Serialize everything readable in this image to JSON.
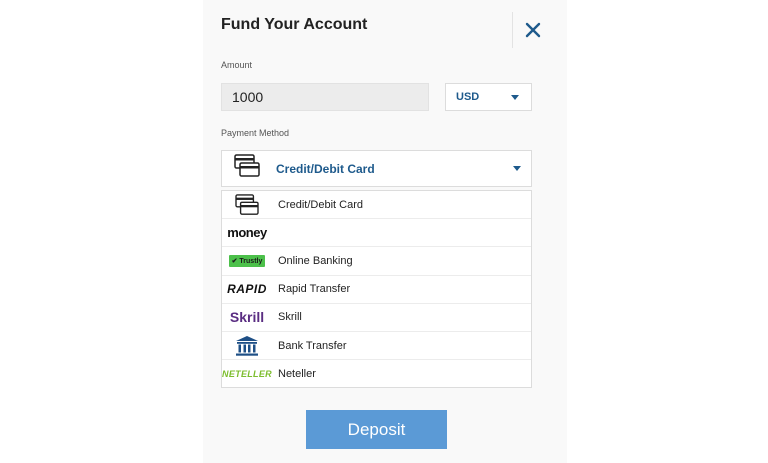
{
  "dialog": {
    "title": "Fund Your Account",
    "close_icon": "close-icon"
  },
  "amount": {
    "label": "Amount",
    "value": "1000",
    "currency": "USD"
  },
  "payment": {
    "label": "Payment Method",
    "selected": "Credit/Debit Card",
    "selected_icon": "credit-card-icon",
    "options": [
      {
        "label": "Credit/Debit Card",
        "logo": "credit-card-icon"
      },
      {
        "label": "",
        "logo": "money-logo",
        "logo_text": "money"
      },
      {
        "label": "Online Banking",
        "logo": "trustly-logo",
        "logo_text": "Trustly"
      },
      {
        "label": "Rapid Transfer",
        "logo": "rapid-logo",
        "logo_text": "RAPID"
      },
      {
        "label": "Skrill",
        "logo": "skrill-logo",
        "logo_text": "Skrill"
      },
      {
        "label": "Bank Transfer",
        "logo": "bank-icon"
      },
      {
        "label": "Neteller",
        "logo": "neteller-logo",
        "logo_text": "NETELLER"
      }
    ]
  },
  "deposit_label": "Deposit",
  "colors": {
    "accent_blue": "#1e5a8c",
    "deposit_button": "#5b9ad6",
    "close_icon": "#1e5a8c"
  }
}
